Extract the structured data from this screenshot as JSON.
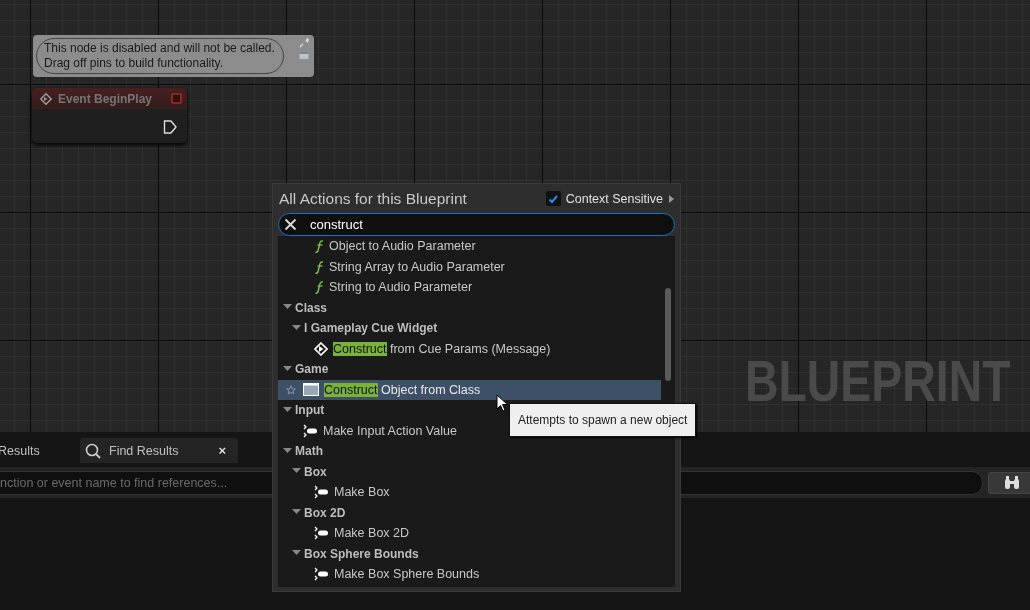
{
  "graph": {
    "comment": {
      "text": "This node is disabled and will not be called.\nDrag off pins to build functionality."
    },
    "node": {
      "title": "Event BeginPlay",
      "disabled": true
    },
    "watermark": "BLUEPRINT"
  },
  "action_menu": {
    "title": "All Actions for this Blueprint",
    "context_sensitive": {
      "label": "Context Sensitive",
      "checked": true
    },
    "search": {
      "value": "construct"
    },
    "results": [
      {
        "kind": "function",
        "label": "Object to Audio Parameter",
        "selected": false
      },
      {
        "kind": "function",
        "label": "String Array to Audio Parameter",
        "selected": false
      },
      {
        "kind": "function",
        "label": "String to Audio Parameter",
        "selected": false
      },
      {
        "kind": "category",
        "label": "Class",
        "expanded": true,
        "children": [
          {
            "kind": "category",
            "label": "I Gameplay Cue Widget",
            "expanded": true,
            "children": [
              {
                "kind": "event",
                "match": "Construct",
                "label": " from Cue Params (Message)",
                "selected": false
              }
            ]
          }
        ]
      },
      {
        "kind": "category",
        "label": "Game",
        "expanded": true,
        "children": [
          {
            "kind": "class",
            "match": "Construct",
            "label": " Object from Class",
            "selected": true
          }
        ]
      },
      {
        "kind": "category",
        "label": "Input",
        "expanded": true,
        "children": [
          {
            "kind": "make",
            "label": "Make Input Action Value",
            "selected": false
          }
        ]
      },
      {
        "kind": "category",
        "label": "Math",
        "expanded": true,
        "children": [
          {
            "kind": "category",
            "label": "Box",
            "expanded": true,
            "children": [
              {
                "kind": "make",
                "label": "Make Box",
                "selected": false
              }
            ]
          },
          {
            "kind": "category",
            "label": "Box 2D",
            "expanded": true,
            "children": [
              {
                "kind": "make",
                "label": "Make Box 2D",
                "selected": false
              }
            ]
          },
          {
            "kind": "category",
            "label": "Box Sphere Bounds",
            "expanded": true,
            "children": [
              {
                "kind": "make",
                "label": "Make Box Sphere Bounds",
                "selected": false
              }
            ]
          }
        ]
      }
    ]
  },
  "tooltip": {
    "text": "Attempts to spawn a new object"
  },
  "bottom_panel": {
    "tabs": [
      {
        "label": "Results",
        "selected": false
      },
      {
        "label": "Find Results",
        "selected": true,
        "close": "×"
      }
    ],
    "search": {
      "placeholder": "nction or event name to find references..."
    }
  }
}
